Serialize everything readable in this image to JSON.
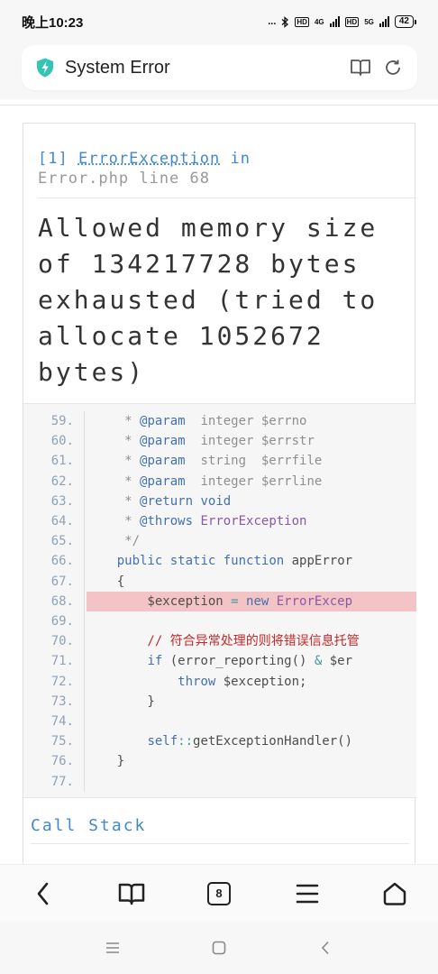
{
  "status_bar": {
    "time": "晚上10:23",
    "dots": "...",
    "net_4g": "4G",
    "net_5g": "5G",
    "hd": "HD",
    "battery": "42"
  },
  "address_bar": {
    "title": "System Error",
    "shield_color": "#34c4b4"
  },
  "error": {
    "index": "[1]",
    "exception_class": "ErrorException",
    "in_word": "in",
    "file_line": "Error.php line 68",
    "message": "Allowed memory size of 134217728 bytes exhausted (tried to allocate 1052672 bytes)"
  },
  "source": {
    "lines": [
      {
        "no": "59.",
        "code": "     * @param  integer $errno"
      },
      {
        "no": "60.",
        "code": "     * @param  integer $errstr"
      },
      {
        "no": "61.",
        "code": "     * @param  string  $errfile"
      },
      {
        "no": "62.",
        "code": "     * @param  integer $errline"
      },
      {
        "no": "63.",
        "code": "     * @return void"
      },
      {
        "no": "64.",
        "code": "     * @throws ErrorException"
      },
      {
        "no": "65.",
        "code": "     */"
      },
      {
        "no": "66.",
        "code": "    public static function appError"
      },
      {
        "no": "67.",
        "code": "    {"
      },
      {
        "no": "68.",
        "code": "        $exception = new ErrorExcep",
        "highlight": true
      },
      {
        "no": "69.",
        "code": ""
      },
      {
        "no": "70.",
        "code": "        // 符合异常处理的则将错误信息托管"
      },
      {
        "no": "71.",
        "code": "        if (error_reporting() & $er"
      },
      {
        "no": "72.",
        "code": "            throw $exception;"
      },
      {
        "no": "73.",
        "code": "        }"
      },
      {
        "no": "74.",
        "code": ""
      },
      {
        "no": "75.",
        "code": "        self::getExceptionHandler()"
      },
      {
        "no": "76.",
        "code": "    }"
      },
      {
        "no": "77.",
        "code": ""
      }
    ]
  },
  "call_stack_label": "Call Stack",
  "toolbar": {
    "tab_count": "8"
  },
  "colors": {
    "accent_blue": "#4288ce",
    "highlight_row": "#f4c3c5",
    "code_bg": "#f6f6f6"
  }
}
